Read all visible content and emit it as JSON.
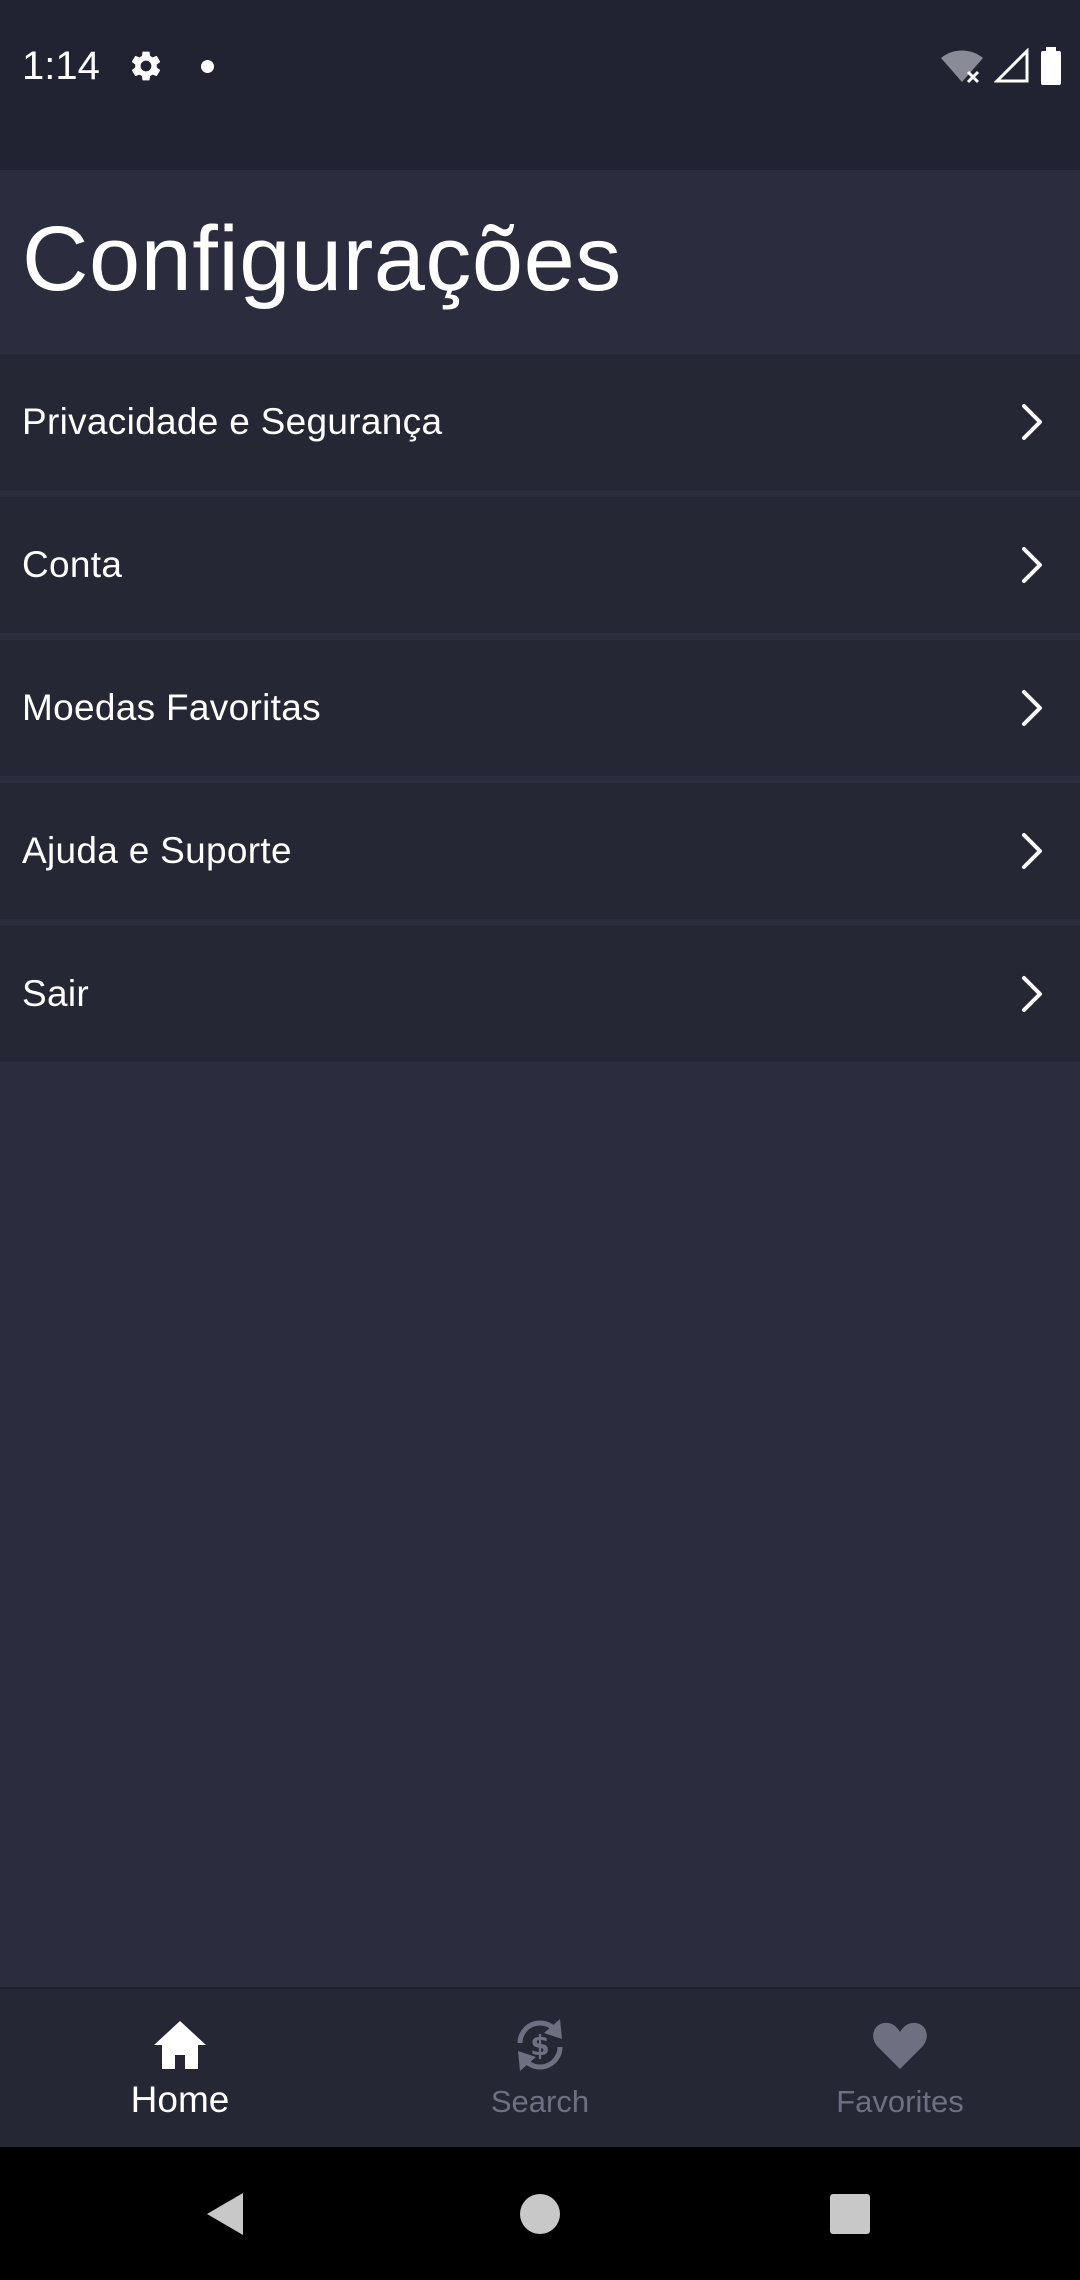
{
  "status_bar": {
    "time": "1:14",
    "icons": [
      "settings-icon",
      "notification-dot-icon",
      "wifi-off-icon",
      "signal-icon",
      "battery-icon"
    ]
  },
  "header": {
    "title": "Configurações"
  },
  "settings": {
    "items": [
      {
        "label": "Privacidade e Segurança",
        "icon": "chevron-right-icon"
      },
      {
        "label": "Conta",
        "icon": "chevron-right-icon"
      },
      {
        "label": "Moedas Favoritas",
        "icon": "chevron-right-icon"
      },
      {
        "label": "Ajuda e Suporte",
        "icon": "chevron-right-icon"
      },
      {
        "label": "Sair",
        "icon": "chevron-right-icon"
      }
    ]
  },
  "bottom_nav": {
    "items": [
      {
        "label": "Home",
        "icon": "home-icon",
        "active": true
      },
      {
        "label": "Search",
        "icon": "currency-exchange-icon",
        "active": false
      },
      {
        "label": "Favorites",
        "icon": "heart-icon",
        "active": false
      }
    ]
  },
  "system_nav": {
    "buttons": [
      "back-icon",
      "home-circle-icon",
      "recents-icon"
    ]
  },
  "colors": {
    "background": "#2b2c3e",
    "status_bar": "#222332",
    "list_item": "#262735",
    "text": "#ffffff",
    "inactive": "#6e6f80"
  }
}
